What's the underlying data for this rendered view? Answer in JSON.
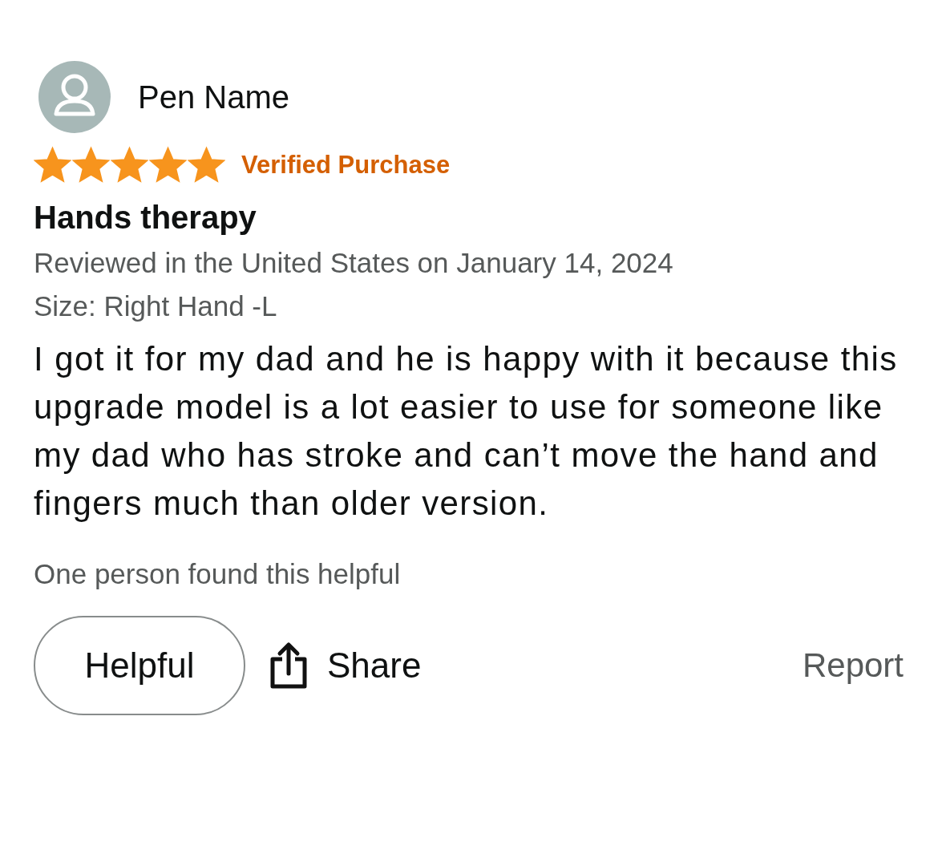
{
  "reviewer": {
    "name": "Pen Name"
  },
  "rating": {
    "stars": 5,
    "badge": "Verified Purchase"
  },
  "title": "Hands therapy",
  "meta": [
    "Reviewed in the United States on January 14, 2024",
    "Size: Right Hand -L"
  ],
  "body": "I got it for my dad and he is happy with it because this upgrade model is a lot easier to use for someone like my dad who has stroke and can’t move the hand and fingers much than older version.",
  "helpful_note": "One person found this helpful",
  "actions": {
    "helpful": "Helpful",
    "share": "Share",
    "report": "Report"
  }
}
